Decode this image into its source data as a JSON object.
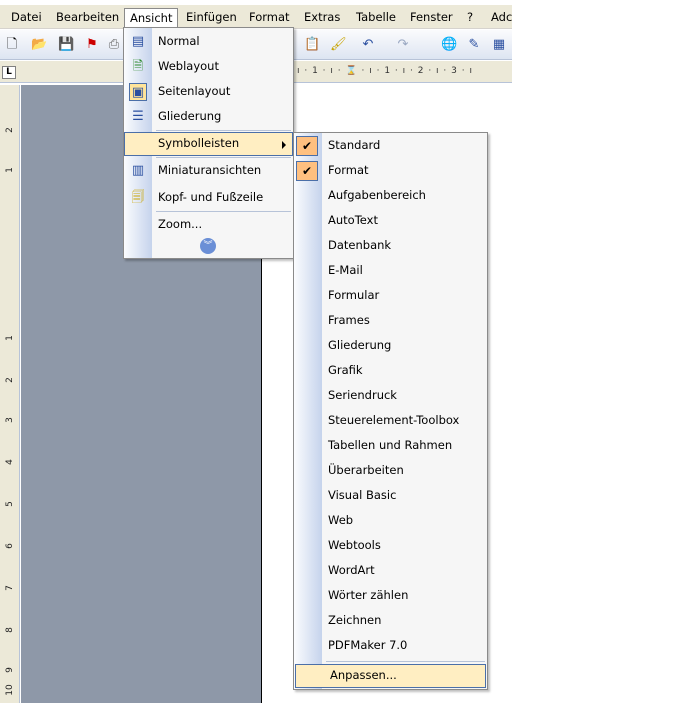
{
  "menubar": {
    "items": [
      {
        "label": "Datei",
        "key": "datei"
      },
      {
        "label": "Bearbeiten",
        "key": "bearbeiten"
      },
      {
        "label": "Ansicht",
        "key": "ansicht"
      },
      {
        "label": "Einfügen",
        "key": "einfuegen"
      },
      {
        "label": "Format",
        "key": "format"
      },
      {
        "label": "Extras",
        "key": "extras"
      },
      {
        "label": "Tabelle",
        "key": "tabelle"
      },
      {
        "label": "Fenster",
        "key": "fenster"
      },
      {
        "label": "?",
        "key": "help"
      },
      {
        "label": "Adc",
        "key": "adobe"
      }
    ],
    "active": "Ansicht"
  },
  "toolbar": {
    "icons": [
      "new-document-icon",
      "open-folder-icon",
      "save-icon",
      "pdf-icon",
      "print-icon",
      "paste-icon",
      "format-painter-icon",
      "undo-icon",
      "redo-icon",
      "hyperlink-icon",
      "tables-borders-icon",
      "insert-table-icon"
    ]
  },
  "ruler": {
    "horizontal_text": "ı · 1 · ı · ⌛ · ı · 1 · ı · 2 · ı · 3 · ı",
    "tab_button": "L",
    "vertical_numbers": [
      "2",
      "1",
      "1",
      "2",
      "3",
      "4",
      "5",
      "6",
      "7",
      "8",
      "9",
      "10",
      "11"
    ]
  },
  "ansicht_menu": {
    "items": [
      {
        "label": "Normal",
        "icon": "normal-view-icon"
      },
      {
        "label": "Weblayout",
        "icon": "web-layout-icon"
      },
      {
        "label": "Seitenlayout",
        "icon": "page-layout-icon"
      },
      {
        "label": "Gliederung",
        "icon": "outline-view-icon"
      },
      {
        "label": "Symbolleisten",
        "icon": "",
        "submenu": true
      },
      {
        "label": "Miniaturansichten",
        "icon": "thumbnails-icon"
      },
      {
        "label": "Kopf- und Fußzeile",
        "icon": "header-footer-icon"
      },
      {
        "label": "Zoom...",
        "icon": ""
      }
    ],
    "highlighted": "Symbolleisten"
  },
  "symbolleisten_menu": {
    "items": [
      {
        "label": "Standard",
        "checked": true
      },
      {
        "label": "Format",
        "checked": true
      },
      {
        "label": "Aufgabenbereich",
        "checked": false
      },
      {
        "label": "AutoText",
        "checked": false
      },
      {
        "label": "Datenbank",
        "checked": false
      },
      {
        "label": "E-Mail",
        "checked": false
      },
      {
        "label": "Formular",
        "checked": false
      },
      {
        "label": "Frames",
        "checked": false
      },
      {
        "label": "Gliederung",
        "checked": false
      },
      {
        "label": "Grafik",
        "checked": false
      },
      {
        "label": "Seriendruck",
        "checked": false
      },
      {
        "label": "Steuerelement-Toolbox",
        "checked": false
      },
      {
        "label": "Tabellen und Rahmen",
        "checked": false
      },
      {
        "label": "Überarbeiten",
        "checked": false
      },
      {
        "label": "Visual Basic",
        "checked": false
      },
      {
        "label": "Web",
        "checked": false
      },
      {
        "label": "Webtools",
        "checked": false
      },
      {
        "label": "WordArt",
        "checked": false
      },
      {
        "label": "Wörter zählen",
        "checked": false
      },
      {
        "label": "Zeichnen",
        "checked": false
      },
      {
        "label": "PDFMaker 7.0",
        "checked": false
      }
    ],
    "customize_label": "Anpassen...",
    "check_glyph": "✔"
  },
  "colors": {
    "highlight": "#ffeec2",
    "highlight_border": "#4b6fa8",
    "check_bg": "#ffc080",
    "page_area": "#8e98a8"
  }
}
